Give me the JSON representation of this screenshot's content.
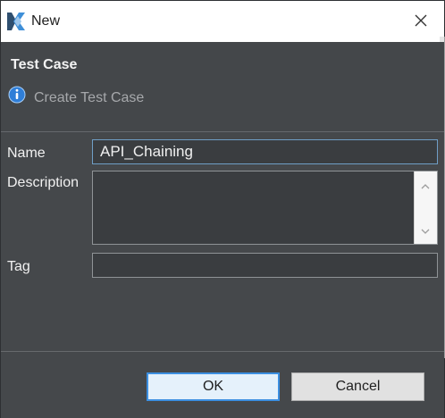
{
  "window": {
    "title": "New",
    "close_glyph": "✕",
    "icon": "app-logo-icon"
  },
  "header": {
    "title": "Test Case",
    "info_icon": "info-icon",
    "subtitle": "Create Test Case"
  },
  "form": {
    "name_label": "Name",
    "name_value": "API_Chaining",
    "description_label": "Description",
    "description_value": "",
    "tag_label": "Tag",
    "tag_value": ""
  },
  "footer": {
    "ok_label": "OK",
    "cancel_label": "Cancel"
  },
  "colors": {
    "dialog_background": "#45484b",
    "title_bar": "#ffffff",
    "focus_border": "#3c8fe1",
    "info_blue": "#2f7ed8"
  }
}
